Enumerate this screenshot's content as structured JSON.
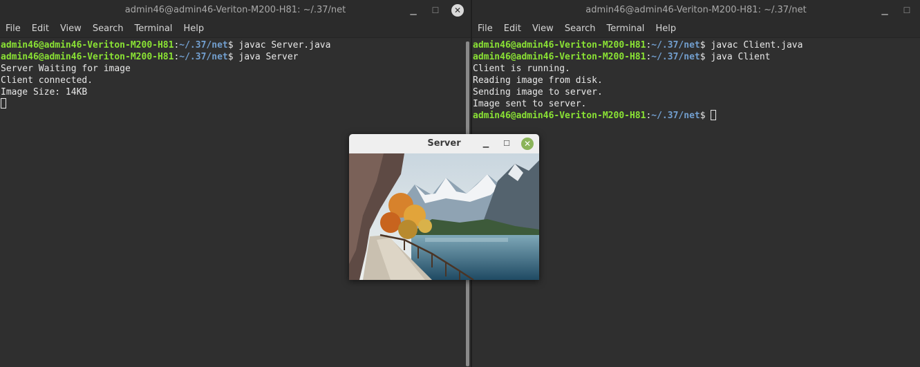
{
  "left_terminal": {
    "title": "admin46@admin46-Veriton-M200-H81: ~/.37/net",
    "menu": [
      "File",
      "Edit",
      "View",
      "Search",
      "Terminal",
      "Help"
    ],
    "lines": [
      {
        "type": "prompt",
        "user": "admin46@admin46-Veriton-M200-H81",
        "path": "~/.37/net",
        "cmd": "javac Server.java"
      },
      {
        "type": "prompt",
        "user": "admin46@admin46-Veriton-M200-H81",
        "path": "~/.37/net",
        "cmd": "java Server"
      },
      {
        "type": "output",
        "text": "Server Waiting for image"
      },
      {
        "type": "output",
        "text": "Client connected."
      },
      {
        "type": "output",
        "text": "Image Size: 14KB"
      }
    ]
  },
  "right_terminal": {
    "title": "admin46@admin46-Veriton-M200-H81: ~/.37/net",
    "menu": [
      "File",
      "Edit",
      "View",
      "Search",
      "Terminal",
      "Help"
    ],
    "lines": [
      {
        "type": "prompt",
        "user": "admin46@admin46-Veriton-M200-H81",
        "path": "~/.37/net",
        "cmd": "javac Client.java"
      },
      {
        "type": "prompt",
        "user": "admin46@admin46-Veriton-M200-H81",
        "path": "~/.37/net",
        "cmd": "java Client"
      },
      {
        "type": "output",
        "text": "Client is running."
      },
      {
        "type": "output",
        "text": "Reading image from disk."
      },
      {
        "type": "output",
        "text": "Sending image to server."
      },
      {
        "type": "output",
        "text": "Image sent to server."
      }
    ],
    "final_prompt": {
      "user": "admin46@admin46-Veriton-M200-H81",
      "path": "~/.37/net"
    }
  },
  "server_window": {
    "title": "Server"
  },
  "colors": {
    "prompt_user": "#8ae234",
    "prompt_path": "#729fcf",
    "terminal_bg": "#2f2f2f"
  },
  "icons": [
    "minimize-icon",
    "maximize-icon",
    "close-icon"
  ]
}
